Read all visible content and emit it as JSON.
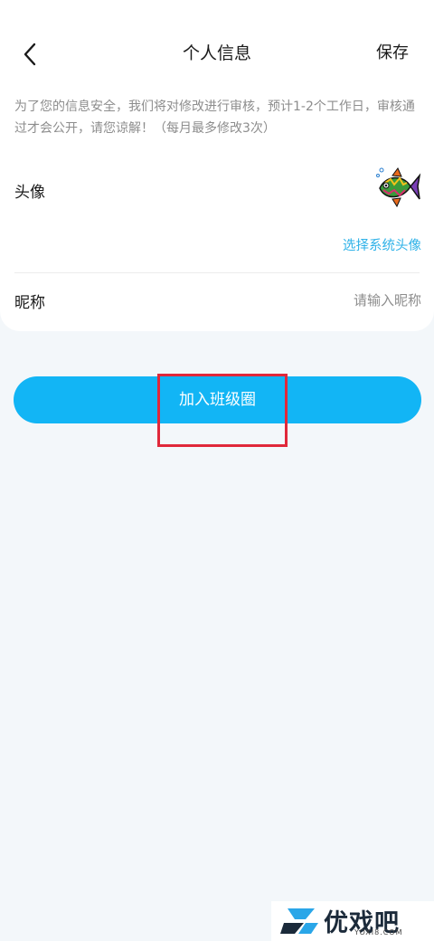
{
  "header": {
    "title": "个人信息",
    "save_label": "保存",
    "back_icon": "chevron-left-icon"
  },
  "notice": "为了您的信息安全，我们将对修改进行审核，预计1-2个工作日，审核通过才会公开，请您谅解！（每月最多修改3次）",
  "avatar": {
    "label": "头像",
    "pick_label": "选择系统头像",
    "icon": "fish-avatar-icon"
  },
  "nickname": {
    "label": "昵称",
    "placeholder": "请输入昵称",
    "value": ""
  },
  "join_button": {
    "label": "加入班级圈"
  },
  "watermark": {
    "text": "优戏吧",
    "sub": "YOXI8.COM"
  },
  "colors": {
    "accent": "#12b5f5",
    "link": "#2fb2e8",
    "highlight": "#e0283a",
    "background": "#f3f7fa"
  }
}
